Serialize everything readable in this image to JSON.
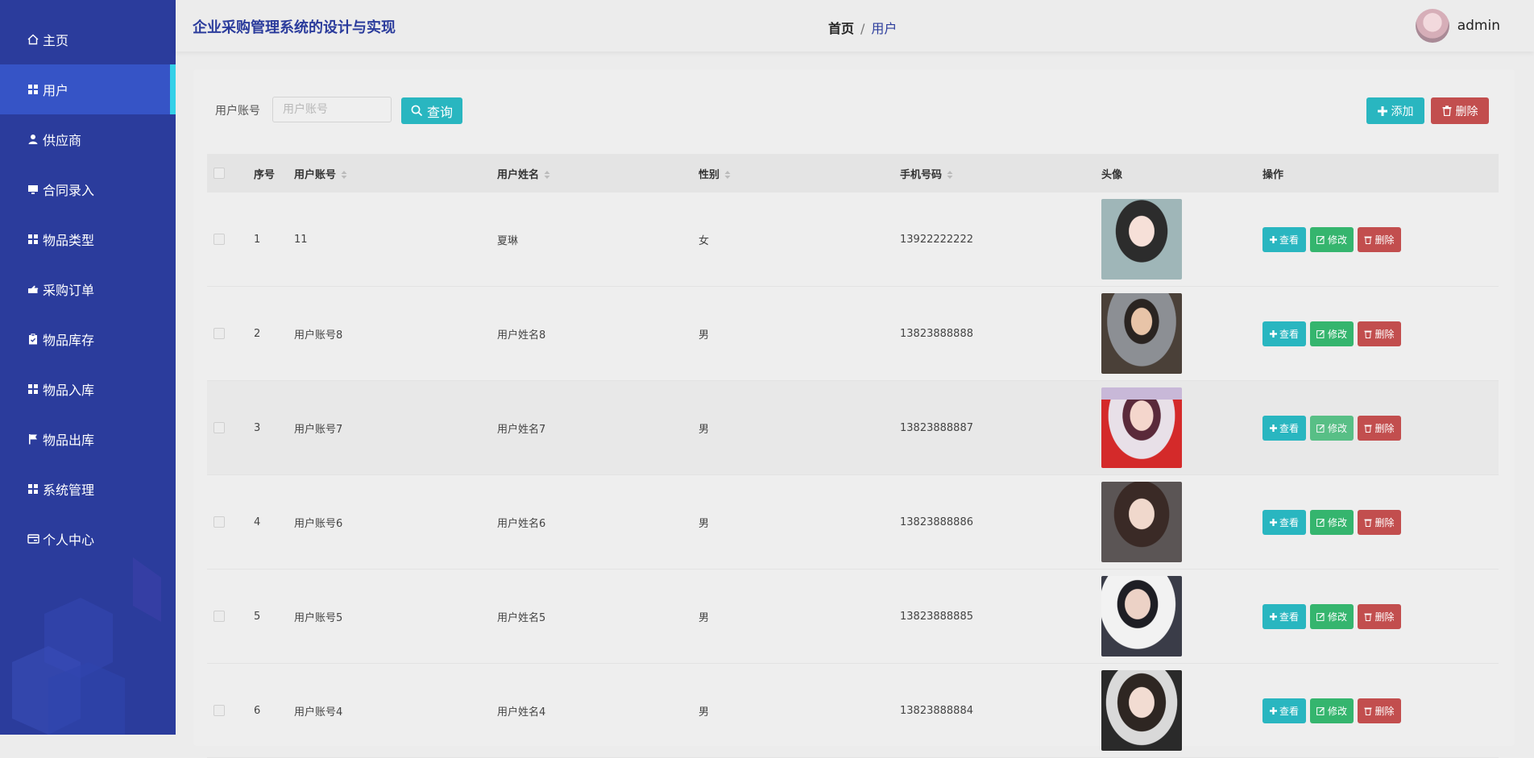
{
  "sidebar": {
    "items": [
      {
        "label": "主页",
        "icon": "home-icon",
        "active": false
      },
      {
        "label": "用户",
        "icon": "grid-icon",
        "active": true
      },
      {
        "label": "供应商",
        "icon": "person-icon",
        "active": false
      },
      {
        "label": "合同录入",
        "icon": "monitor-icon",
        "active": false
      },
      {
        "label": "物品类型",
        "icon": "grid-icon",
        "active": false
      },
      {
        "label": "采购订单",
        "icon": "hand-icon",
        "active": false
      },
      {
        "label": "物品库存",
        "icon": "clipboard-icon",
        "active": false
      },
      {
        "label": "物品入库",
        "icon": "grid-icon",
        "active": false
      },
      {
        "label": "物品出库",
        "icon": "flag-icon",
        "active": false
      },
      {
        "label": "系统管理",
        "icon": "grid-icon",
        "active": false
      },
      {
        "label": "个人中心",
        "icon": "card-icon",
        "active": false
      }
    ]
  },
  "header": {
    "title": "企业采购管理系统的设计与实现",
    "breadcrumb_home": "首页",
    "breadcrumb_sep": "/",
    "breadcrumb_current": "用户",
    "username": "admin"
  },
  "search": {
    "label": "用户账号",
    "placeholder": "用户账号",
    "value": "",
    "query_label": "查询"
  },
  "toolbar": {
    "add_label": "添加",
    "delete_label": "删除"
  },
  "table": {
    "headers": {
      "no": "序号",
      "account": "用户账号",
      "name": "用户姓名",
      "sex": "性别",
      "phone": "手机号码",
      "avatar": "头像",
      "ops": "操作"
    },
    "rows": [
      {
        "no": "1",
        "account": "11",
        "name": "夏琳",
        "sex": "女",
        "phone": "13922222222"
      },
      {
        "no": "2",
        "account": "用户账号8",
        "name": "用户姓名8",
        "sex": "男",
        "phone": "13823888888"
      },
      {
        "no": "3",
        "account": "用户账号7",
        "name": "用户姓名7",
        "sex": "男",
        "phone": "13823888887"
      },
      {
        "no": "4",
        "account": "用户账号6",
        "name": "用户姓名6",
        "sex": "男",
        "phone": "13823888886"
      },
      {
        "no": "5",
        "account": "用户账号5",
        "name": "用户姓名5",
        "sex": "男",
        "phone": "13823888885"
      },
      {
        "no": "6",
        "account": "用户账号4",
        "name": "用户姓名4",
        "sex": "男",
        "phone": "13823888884"
      }
    ],
    "row_actions": {
      "view": "查看",
      "edit": "修改",
      "delete": "删除"
    }
  },
  "colors": {
    "sidebar_bg": "#2b3c9c",
    "sidebar_active": "#3654c6",
    "accent_cyan": "#29b6c0",
    "edit_green": "#35b56e",
    "danger_red": "#c24e4e"
  }
}
